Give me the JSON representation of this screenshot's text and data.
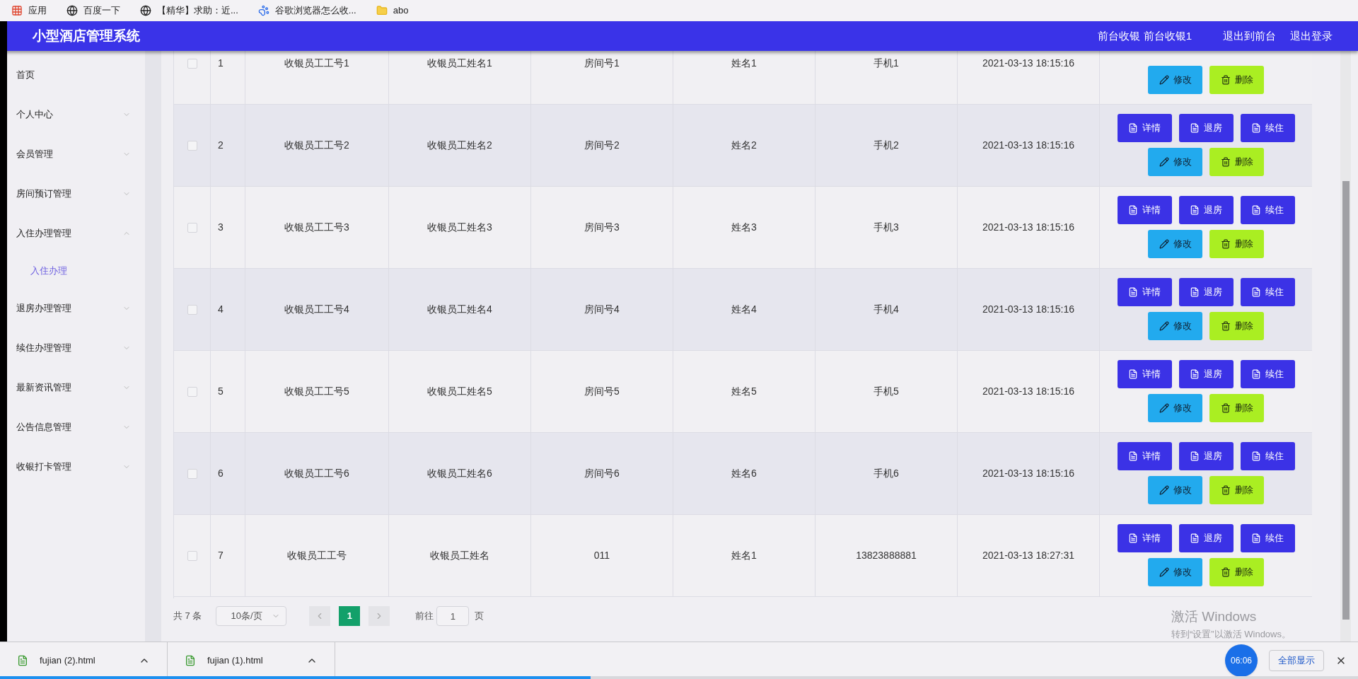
{
  "bookmarks": [
    {
      "kind": "apps",
      "label": "应用"
    },
    {
      "kind": "globe",
      "label": "百度一下"
    },
    {
      "kind": "globe",
      "label": "【精华】求助：近..."
    },
    {
      "kind": "paw",
      "label": "谷歌浏览器怎么收..."
    },
    {
      "kind": "folder",
      "label": "abo"
    }
  ],
  "header": {
    "title": "小型酒店管理系统",
    "user": "前台收银 前台收银1",
    "links": [
      "退出到前台",
      "退出登录"
    ]
  },
  "sidebar": {
    "items": [
      {
        "label": "首页",
        "expandable": false
      },
      {
        "label": "个人中心",
        "expandable": true,
        "expanded": false
      },
      {
        "label": "会员管理",
        "expandable": true,
        "expanded": false
      },
      {
        "label": "房间预订管理",
        "expandable": true,
        "expanded": false
      },
      {
        "label": "入住办理管理",
        "expandable": true,
        "expanded": true,
        "children": [
          {
            "label": "入住办理",
            "selected": true
          }
        ]
      },
      {
        "label": "退房办理管理",
        "expandable": true,
        "expanded": false
      },
      {
        "label": "续住办理管理",
        "expandable": true,
        "expanded": false
      },
      {
        "label": "最新资讯管理",
        "expandable": true,
        "expanded": false
      },
      {
        "label": "公告信息管理",
        "expandable": true,
        "expanded": false
      },
      {
        "label": "收银打卡管理",
        "expandable": true,
        "expanded": false
      }
    ]
  },
  "table": {
    "rows": [
      {
        "selected": false,
        "cells": [
          "1",
          "收银员工工号1",
          "收银员工姓名1",
          "房间号1",
          "姓名1",
          "手机1",
          "2021-03-13 18:15:16"
        ],
        "actions": [
          {
            "kind": "edit",
            "label": "修改"
          },
          {
            "kind": "delete",
            "label": "删除"
          }
        ]
      },
      {
        "selected": false,
        "cells": [
          "2",
          "收银员工工号2",
          "收银员工姓名2",
          "房间号2",
          "姓名2",
          "手机2",
          "2021-03-13 18:15:16"
        ],
        "actions": [
          {
            "kind": "detail",
            "label": "详情"
          },
          {
            "kind": "detail",
            "label": "退房"
          },
          {
            "kind": "detail",
            "label": "续住"
          },
          {
            "kind": "edit",
            "label": "修改"
          },
          {
            "kind": "delete",
            "label": "删除"
          }
        ]
      },
      {
        "selected": false,
        "cells": [
          "3",
          "收银员工工号3",
          "收银员工姓名3",
          "房间号3",
          "姓名3",
          "手机3",
          "2021-03-13 18:15:16"
        ],
        "actions": [
          {
            "kind": "detail",
            "label": "详情"
          },
          {
            "kind": "detail",
            "label": "退房"
          },
          {
            "kind": "detail",
            "label": "续住"
          },
          {
            "kind": "edit",
            "label": "修改"
          },
          {
            "kind": "delete",
            "label": "删除"
          }
        ]
      },
      {
        "selected": false,
        "cells": [
          "4",
          "收银员工工号4",
          "收银员工姓名4",
          "房间号4",
          "姓名4",
          "手机4",
          "2021-03-13 18:15:16"
        ],
        "actions": [
          {
            "kind": "detail",
            "label": "详情"
          },
          {
            "kind": "detail",
            "label": "退房"
          },
          {
            "kind": "detail",
            "label": "续住"
          },
          {
            "kind": "edit",
            "label": "修改"
          },
          {
            "kind": "delete",
            "label": "删除"
          }
        ]
      },
      {
        "selected": false,
        "cells": [
          "5",
          "收银员工工号5",
          "收银员工姓名5",
          "房间号5",
          "姓名5",
          "手机5",
          "2021-03-13 18:15:16"
        ],
        "actions": [
          {
            "kind": "detail",
            "label": "详情"
          },
          {
            "kind": "detail",
            "label": "退房"
          },
          {
            "kind": "detail",
            "label": "续住"
          },
          {
            "kind": "edit",
            "label": "修改"
          },
          {
            "kind": "delete",
            "label": "删除"
          }
        ]
      },
      {
        "selected": false,
        "cells": [
          "6",
          "收银员工工号6",
          "收银员工姓名6",
          "房间号6",
          "姓名6",
          "手机6",
          "2021-03-13 18:15:16"
        ],
        "actions": [
          {
            "kind": "detail",
            "label": "详情"
          },
          {
            "kind": "detail",
            "label": "退房"
          },
          {
            "kind": "detail",
            "label": "续住"
          },
          {
            "kind": "edit",
            "label": "修改"
          },
          {
            "kind": "delete",
            "label": "删除"
          }
        ]
      },
      {
        "selected": false,
        "cells": [
          "7",
          "收银员工工号",
          "收银员工姓名",
          "011",
          "姓名1",
          "13823888881",
          "2021-03-13 18:27:31"
        ],
        "actions": [
          {
            "kind": "detail",
            "label": "详情"
          },
          {
            "kind": "detail",
            "label": "退房"
          },
          {
            "kind": "detail",
            "label": "续住"
          },
          {
            "kind": "edit",
            "label": "修改"
          },
          {
            "kind": "delete",
            "label": "删除"
          }
        ]
      }
    ]
  },
  "pagination": {
    "total": "共 7 条",
    "page_size": "10条/页",
    "pages": [
      {
        "label": "1",
        "selected": true
      }
    ],
    "goto_label": "前往",
    "goto_value": "1",
    "goto_suffix": "页"
  },
  "activation": {
    "title": "激活 Windows",
    "hint": "转到“设置”以激活 Windows。"
  },
  "downloads": {
    "files": [
      "fujian (2).html",
      "fujian (1).html"
    ],
    "show_all": "全部显示"
  },
  "timer": "06:06",
  "video_progress": {
    "level": 0.435
  }
}
